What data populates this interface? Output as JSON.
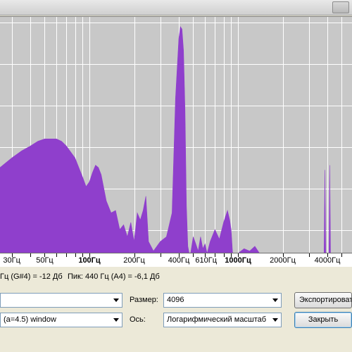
{
  "window": {
    "title": ""
  },
  "chart_data": {
    "type": "area",
    "x_scale": "log",
    "xlim": [
      15,
      7000
    ],
    "ylim_db": [
      -100,
      -5
    ],
    "grid": true,
    "fill_color": "#8f3fcc",
    "grid_color": "#ffffff",
    "background": "#c8c8c8",
    "tick_labels": [
      {
        "value": 30,
        "label": "30Гц",
        "bold": false
      },
      {
        "value": 50,
        "label": "50Гц",
        "bold": false
      },
      {
        "value": 100,
        "label": "100Гц",
        "bold": true
      },
      {
        "value": 200,
        "label": "200Гц",
        "bold": false
      },
      {
        "value": 400,
        "label": "400Гц",
        "bold": false
      },
      {
        "value": 610,
        "label": "610Гц",
        "bold": false
      },
      {
        "value": 1000,
        "label": "1000Гц",
        "bold": true
      },
      {
        "value": 2000,
        "label": "2000Гц",
        "bold": false
      },
      {
        "value": 4000,
        "label": "4000Гц",
        "bold": false
      }
    ],
    "x": [
      15,
      20,
      25,
      30,
      35,
      40,
      45,
      50,
      55,
      60,
      65,
      70,
      80,
      90,
      95,
      100,
      105,
      110,
      115,
      120,
      130,
      140,
      150,
      160,
      170,
      180,
      190,
      200,
      210,
      220,
      230,
      240,
      250,
      270,
      300,
      330,
      360,
      380,
      400,
      410,
      420,
      430,
      440,
      450,
      460,
      470,
      480,
      500,
      520,
      540,
      560,
      580,
      600,
      620,
      650,
      700,
      750,
      800,
      850,
      880,
      900,
      920,
      1000,
      1100,
      1200,
      1300,
      1400,
      1500,
      2000,
      2500,
      3000,
      3500,
      3800,
      3850,
      3900,
      4100,
      4150,
      4200,
      5000,
      6000,
      7000
    ],
    "y": [
      -70,
      -68,
      -64,
      -60,
      -57,
      -55,
      -53,
      -52,
      -52,
      -52,
      -53,
      -55,
      -60,
      -68,
      -72,
      -70,
      -66,
      -63,
      -64,
      -67,
      -78,
      -83,
      -82,
      -90,
      -88,
      -93,
      -87,
      -95,
      -83,
      -86,
      -82,
      -76,
      -95,
      -99,
      -95,
      -93,
      -83,
      -35,
      -10,
      -5,
      -6,
      -15,
      -40,
      -80,
      -97,
      -100,
      -100,
      -93,
      -96,
      -99,
      -93,
      -98,
      -96,
      -100,
      -95,
      -90,
      -94,
      -87,
      -82,
      -86,
      -90,
      -100,
      -100,
      -98,
      -99,
      -97,
      -100,
      -100,
      -100,
      -100,
      -100,
      -100,
      -100,
      -65,
      -100,
      -100,
      -63,
      -100,
      -100,
      -100,
      -100
    ]
  },
  "status": {
    "cursor": "Гц (G#4) = -12 Дб",
    "peak": "Пик: 440 Гц (A4) = -6,1 Дб"
  },
  "controls": {
    "algorithm_value": "",
    "function_value": "(a=4.5) window",
    "size_label": "Размер:",
    "size_value": "4096",
    "axis_label": "Ось:",
    "axis_value": "Логарифмический масштаб",
    "export_button": "Экспортировать",
    "close_button": "Закрыть"
  }
}
